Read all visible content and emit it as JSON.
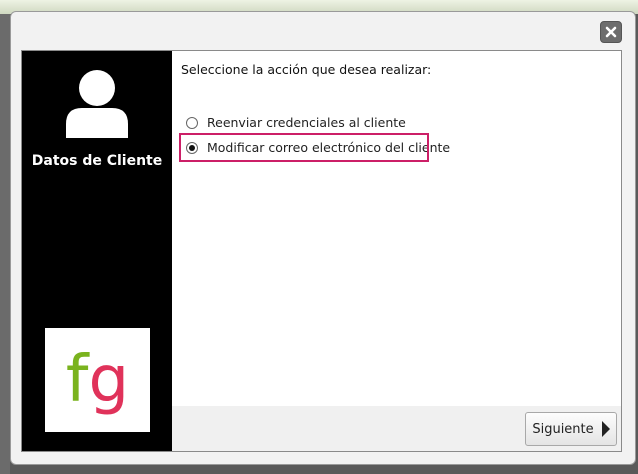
{
  "dialog": {
    "prompt": "Seleccione la acción que desea realizar:",
    "sidebar_title": "Datos de Cliente",
    "options": [
      {
        "label": "Reenviar credenciales al cliente",
        "selected": false
      },
      {
        "label": "Modificar correo electrónico del cliente",
        "selected": true
      }
    ],
    "next_label": "Siguiente"
  },
  "icons": {
    "close": "close-icon",
    "avatar": "user-avatar-icon",
    "next": "caret-right-icon"
  },
  "logo": {
    "f": "f",
    "g": "g"
  },
  "colors": {
    "highlight": "#cc1f67",
    "logo_f": "#7ab31e",
    "logo_g": "#e0325a",
    "sidebar": "#000000"
  }
}
